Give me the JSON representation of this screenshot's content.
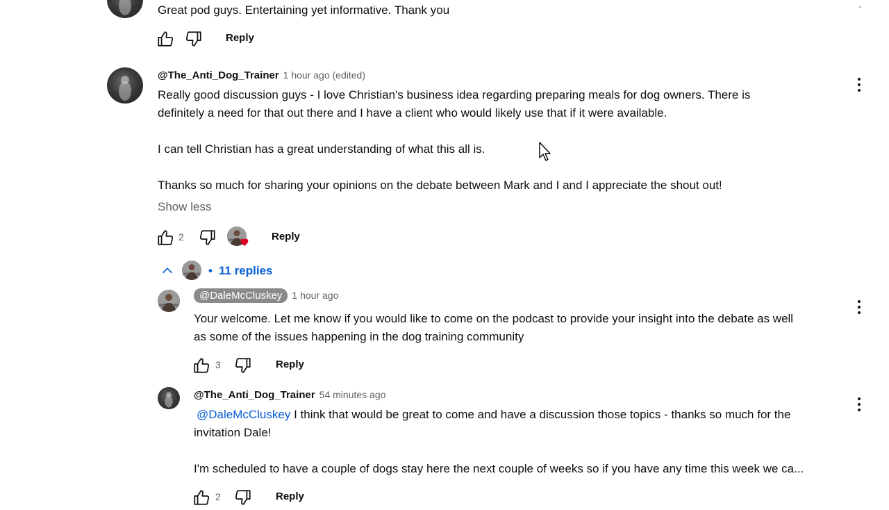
{
  "comment0": {
    "text": "Great pod guys. Entertaining yet informative. Thank you",
    "reply_label": "Reply"
  },
  "comment1": {
    "author": "@The_Anti_Dog_Trainer",
    "time": "1 hour ago (edited)",
    "lines": [
      "Really good discussion guys - I love Christian's business idea regarding preparing meals for dog owners.  There is",
      "definitely a need for that out there and I have a client who would likely use that if it were available.",
      "I can tell Christian has a great understanding of what this all is.",
      "Thanks so much for sharing your opinions on the debate between Mark and I and I appreciate the shout out!"
    ],
    "show_less": "Show less",
    "like_count": "2",
    "reply_label": "Reply",
    "replies_bullet": "•",
    "replies_label": "11 replies"
  },
  "reply1": {
    "author": "@DaleMcCluskey",
    "time": "1 hour ago",
    "lines": [
      "Your welcome.  Let me know if you would like to come on the podcast to provide your insight into the debate as well",
      "as some of the issues happening in the dog training community"
    ],
    "like_count": "3",
    "reply_label": "Reply"
  },
  "reply2": {
    "author": "@The_Anti_Dog_Trainer",
    "time": "54 minutes ago",
    "mention": "@DaleMcCluskey",
    "line1_rest": " I think that would be great to come and have a discussion those topics - thanks so much for the",
    "line2": "invitation Dale!",
    "line3": "I'm scheduled to have a couple of dogs stay here the next couple of weeks so if you have any time this week we ca...",
    "like_count": "2",
    "reply_label": "Reply"
  },
  "colors": {
    "link": "#065fd4",
    "heart": "#e00020",
    "chip_bg": "#8a8a8a"
  }
}
